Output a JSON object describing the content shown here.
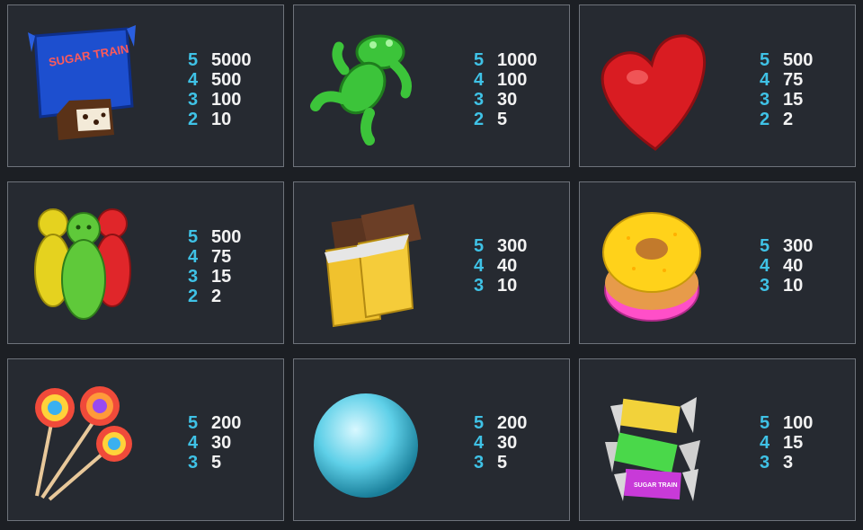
{
  "colors": {
    "background": "#1c1f24",
    "cell_bg": "#262a31",
    "cell_border": "#6e737b",
    "count_color": "#3fc2e6",
    "amount_color": "#f2f2f2"
  },
  "paytable": [
    {
      "symbol": "sugar-train-candy-bar-icon",
      "wrapper_text": "SUGAR TRAIN",
      "pays": [
        {
          "count": "5",
          "amount": "5000"
        },
        {
          "count": "4",
          "amount": "500"
        },
        {
          "count": "3",
          "amount": "100"
        },
        {
          "count": "2",
          "amount": "10"
        }
      ]
    },
    {
      "symbol": "green-gummy-frog-icon",
      "pays": [
        {
          "count": "5",
          "amount": "1000"
        },
        {
          "count": "4",
          "amount": "100"
        },
        {
          "count": "3",
          "amount": "30"
        },
        {
          "count": "2",
          "amount": "5"
        }
      ]
    },
    {
      "symbol": "red-jelly-heart-icon",
      "pays": [
        {
          "count": "5",
          "amount": "500"
        },
        {
          "count": "4",
          "amount": "75"
        },
        {
          "count": "3",
          "amount": "15"
        },
        {
          "count": "2",
          "amount": "2"
        }
      ]
    },
    {
      "symbol": "gummy-bears-icon",
      "pays": [
        {
          "count": "5",
          "amount": "500"
        },
        {
          "count": "4",
          "amount": "75"
        },
        {
          "count": "3",
          "amount": "15"
        },
        {
          "count": "2",
          "amount": "2"
        }
      ]
    },
    {
      "symbol": "chocolate-bars-icon",
      "pays": [
        {
          "count": "5",
          "amount": "300"
        },
        {
          "count": "4",
          "amount": "40"
        },
        {
          "count": "3",
          "amount": "10"
        }
      ]
    },
    {
      "symbol": "donut-stack-icon",
      "pays": [
        {
          "count": "5",
          "amount": "300"
        },
        {
          "count": "4",
          "amount": "40"
        },
        {
          "count": "3",
          "amount": "10"
        }
      ]
    },
    {
      "symbol": "lollipops-icon",
      "pays": [
        {
          "count": "5",
          "amount": "200"
        },
        {
          "count": "4",
          "amount": "30"
        },
        {
          "count": "3",
          "amount": "5"
        }
      ]
    },
    {
      "symbol": "blue-gumball-icon",
      "pays": [
        {
          "count": "5",
          "amount": "200"
        },
        {
          "count": "4",
          "amount": "30"
        },
        {
          "count": "3",
          "amount": "5"
        }
      ]
    },
    {
      "symbol": "wrapped-taffy-icon",
      "wrapper_text": "SUGAR TRAIN",
      "pays": [
        {
          "count": "5",
          "amount": "100"
        },
        {
          "count": "4",
          "amount": "15"
        },
        {
          "count": "3",
          "amount": "3"
        }
      ]
    }
  ]
}
